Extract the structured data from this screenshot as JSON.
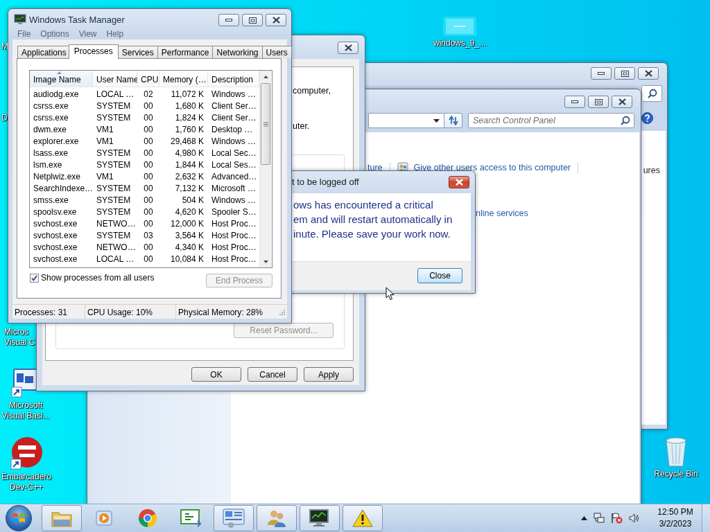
{
  "desktop_icons": [
    {
      "kind": "cut",
      "label": "M"
    },
    {
      "kind": "cut",
      "label": "D"
    },
    {
      "kind": "cut",
      "label": "Micros\nVisual C"
    },
    {
      "kind": "vb",
      "label": "Microsoft\nVisual Basi..."
    },
    {
      "kind": "devcpp",
      "label": "Embarcadero\nDev-C++"
    },
    {
      "kind": "folder",
      "label": "windows_9_..."
    },
    {
      "kind": "recycle",
      "label": "Recycle Bin"
    }
  ],
  "back_window": {
    "fragment": "ures"
  },
  "control_panel": {
    "search": {
      "placeholder": "Search Control Panel"
    },
    "links": [
      {
        "kind": "plain",
        "label": "ture"
      },
      {
        "kind": "users",
        "label": "Give other users access to this computer"
      },
      {
        "kind": "plain",
        "label": "nline services"
      }
    ]
  },
  "user_accounts": {
    "text": [
      "computer,",
      "uter."
    ],
    "reset_button": {
      "label": "Reset Password...",
      "disabled": true
    },
    "buttons": [
      {
        "label": "OK",
        "disabled": false
      },
      {
        "label": "Cancel",
        "disabled": false
      },
      {
        "label": "Apply",
        "disabled": false
      }
    ]
  },
  "dialog": {
    "title": "t to be logged off",
    "message": "ows has encountered a critical\nem and will restart automatically in\ninute. Please save your work now.",
    "button": "Close"
  },
  "task_manager": {
    "title": "Windows Task Manager",
    "menu": [
      "File",
      "Options",
      "View",
      "Help"
    ],
    "tabs": [
      {
        "label": "Applications",
        "selected": false
      },
      {
        "label": "Processes",
        "selected": true
      },
      {
        "label": "Services",
        "selected": false
      },
      {
        "label": "Performance",
        "selected": false
      },
      {
        "label": "Networking",
        "selected": false
      },
      {
        "label": "Users",
        "selected": false
      }
    ],
    "columns": [
      {
        "label": "Image Name",
        "sorted": true
      },
      {
        "label": "User Name",
        "sorted": false
      },
      {
        "label": "CPU",
        "sorted": false
      },
      {
        "label": "Memory (…",
        "sorted": false
      },
      {
        "label": "Description",
        "sorted": false
      }
    ],
    "rows": [
      [
        "audiodg.exe",
        "LOCAL …",
        "02",
        "11,072 K",
        "Windows …"
      ],
      [
        "csrss.exe",
        "SYSTEM",
        "00",
        "1,680 K",
        "Client Ser…"
      ],
      [
        "csrss.exe",
        "SYSTEM",
        "00",
        "1,824 K",
        "Client Ser…"
      ],
      [
        "dwm.exe",
        "VM1",
        "00",
        "1,760 K",
        "Desktop …"
      ],
      [
        "explorer.exe",
        "VM1",
        "00",
        "29,468 K",
        "Windows …"
      ],
      [
        "lsass.exe",
        "SYSTEM",
        "00",
        "4,980 K",
        "Local Sec…"
      ],
      [
        "lsm.exe",
        "SYSTEM",
        "00",
        "1,844 K",
        "Local Ses…"
      ],
      [
        "Netplwiz.exe",
        "VM1",
        "00",
        "2,632 K",
        "Advanced…"
      ],
      [
        "SearchIndexe…",
        "SYSTEM",
        "00",
        "7,132 K",
        "Microsoft …"
      ],
      [
        "smss.exe",
        "SYSTEM",
        "00",
        "504 K",
        "Windows …"
      ],
      [
        "spoolsv.exe",
        "SYSTEM",
        "00",
        "4,620 K",
        "Spooler S…"
      ],
      [
        "svchost.exe",
        "NETWO…",
        "00",
        "12,000 K",
        "Host Proc…"
      ],
      [
        "svchost.exe",
        "SYSTEM",
        "03",
        "3,564 K",
        "Host Proc…"
      ],
      [
        "svchost.exe",
        "NETWO…",
        "00",
        "4,340 K",
        "Host Proc…"
      ],
      [
        "svchost.exe",
        "LOCAL …",
        "00",
        "10,084 K",
        "Host Proc…"
      ]
    ],
    "show_all": {
      "label": "Show processes from all users",
      "checked": true
    },
    "end_process": {
      "label": "End Process",
      "disabled": true
    },
    "status": [
      "Processes: 31",
      "CPU Usage: 10%",
      "Physical Memory: 28%"
    ]
  },
  "taskbar": {
    "apps": [
      {
        "kind": "folder",
        "open": true
      },
      {
        "kind": "media",
        "open": false
      },
      {
        "kind": "browser",
        "open": false
      },
      {
        "kind": "code",
        "open": false
      },
      {
        "kind": "panel",
        "open": true
      },
      {
        "kind": "users",
        "open": true
      },
      {
        "kind": "monitor",
        "open": true
      },
      {
        "kind": "warning",
        "open": true
      }
    ],
    "clock": {
      "time": "12:50 PM",
      "date": "3/2/2023"
    }
  }
}
